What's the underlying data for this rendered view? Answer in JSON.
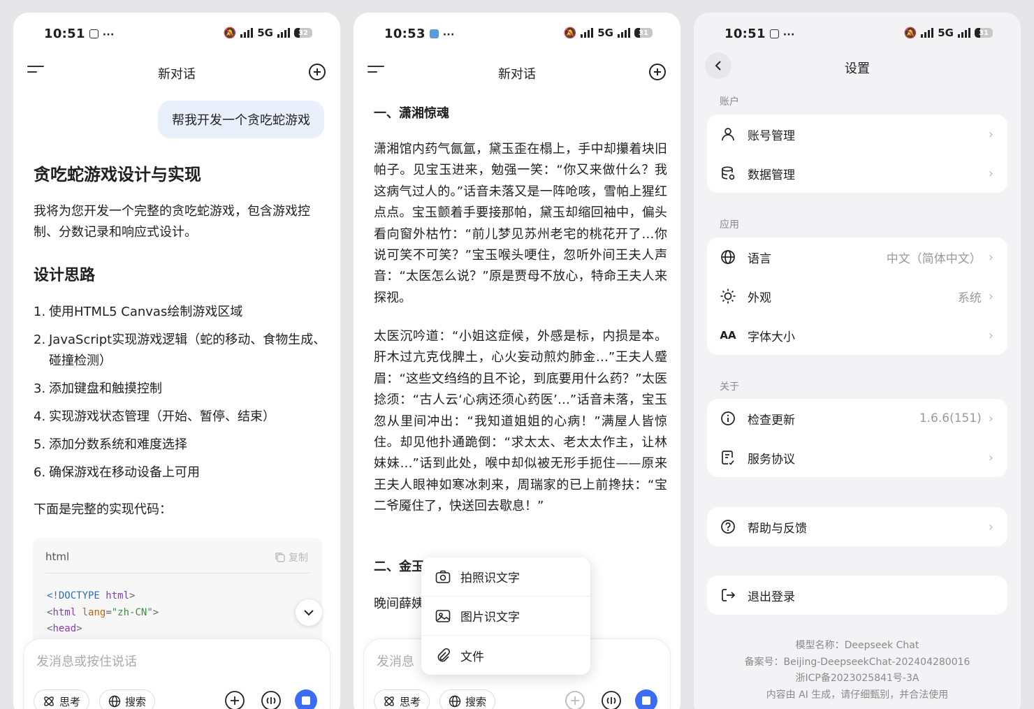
{
  "screen1": {
    "status": {
      "time": "10:51",
      "network": "5G",
      "battery": "32"
    },
    "header": {
      "title": "新对话"
    },
    "user_message": "帮我开发一个贪吃蛇游戏",
    "answer": {
      "title": "贪吃蛇游戏设计与实现",
      "intro": "我将为您开发一个完整的贪吃蛇游戏，包含游戏控制、分数记录和响应式设计。",
      "section_title": "设计思路",
      "steps": [
        "使用HTML5 Canvas绘制游戏区域",
        "JavaScript实现游戏逻辑（蛇的移动、食物生成、碰撞检测）",
        "添加键盘和触摸控制",
        "实现游戏状态管理（开始、暂停、结束）",
        "添加分数系统和难度选择",
        "确保游戏在移动设备上可用"
      ],
      "code_intro": "下面是完整的实现代码：",
      "code": {
        "lang": "html",
        "copy_label": "复制"
      }
    },
    "composer": {
      "placeholder": "发消息或按住说话",
      "think_label": "思考",
      "search_label": "搜索"
    }
  },
  "screen2": {
    "status": {
      "time": "10:53",
      "network": "5G",
      "battery": "31"
    },
    "header": {
      "title": "新对话"
    },
    "section1_title": "一、潇湘惊魂",
    "para1": "潇湘馆内药气氤氲，黛玉歪在榻上，手中却攥着块旧帕子。见宝玉进来，勉强一笑：“你又来做什么？我这病气过人的。”话音未落又是一阵呛咳，雪帕上猩红点点。宝玉颤着手要接那帕，黛玉却缩回袖中，偏头看向窗外枯竹：“前儿梦见苏州老宅的桃花开了…你说可笑不可笑？”宝玉喉头哽住，忽听外间王夫人声音：“太医怎么说？”原是贾母不放心，特命王夫人来探视。",
    "para2": "太医沉吟道：“小姐这症候，外感是标，内损是本。肝木过亢克伐脾土，心火妄动煎灼肺金…”王夫人蹙眉：“这些文绉绉的且不论，到底要用什么药？”太医捻须：“古人云‘心病还须心药医’…”话音未落，宝玉忽从里间冲出：“我知道姐姐的心病！”满屋人皆惊住。却见他扑通跪倒：“求太太、老太太作主，让林妹妹…”话到此处，喉中却似被无形手扼住——原来王夫人眼神如寒冰刺来，周瑞家的已上前搀扶：“宝二爷魇住了，快送回去歇息！”",
    "section2_title": "二、金玉",
    "para3_partial": "晚间薛姨",
    "popup": {
      "items": [
        "拍照识文字",
        "图片识文字",
        "文件"
      ]
    },
    "composer": {
      "placeholder": "发消息",
      "think_label": "思考",
      "search_label": "搜索"
    }
  },
  "screen3": {
    "status": {
      "time": "10:51",
      "network": "5G",
      "battery": "31"
    },
    "title": "设置",
    "sections": {
      "account": {
        "label": "账户",
        "items": [
          "账号管理",
          "数据管理"
        ]
      },
      "app": {
        "label": "应用",
        "items": [
          "语言",
          "外观",
          "字体大小"
        ],
        "values": [
          "中文（简体中文）",
          "系统",
          ""
        ]
      },
      "about": {
        "label": "关于",
        "items": [
          "检查更新",
          "服务协议"
        ],
        "values": [
          "1.6.6(151)",
          ""
        ]
      },
      "help": "帮助与反馈",
      "logout": "退出登录"
    },
    "font_icon_text": "AA",
    "footer": [
      "模型名称：Deepseek Chat",
      "备案号：Beijing-DeepseekChat-202404280016",
      "浙ICP备2023025841号-3A",
      "内容由 AI 生成，请仔细甄别，并合法使用"
    ]
  },
  "colors": {
    "accent": "#3c6cf5",
    "bubble": "#e9effb",
    "settings_bg": "#f3f3f5"
  }
}
